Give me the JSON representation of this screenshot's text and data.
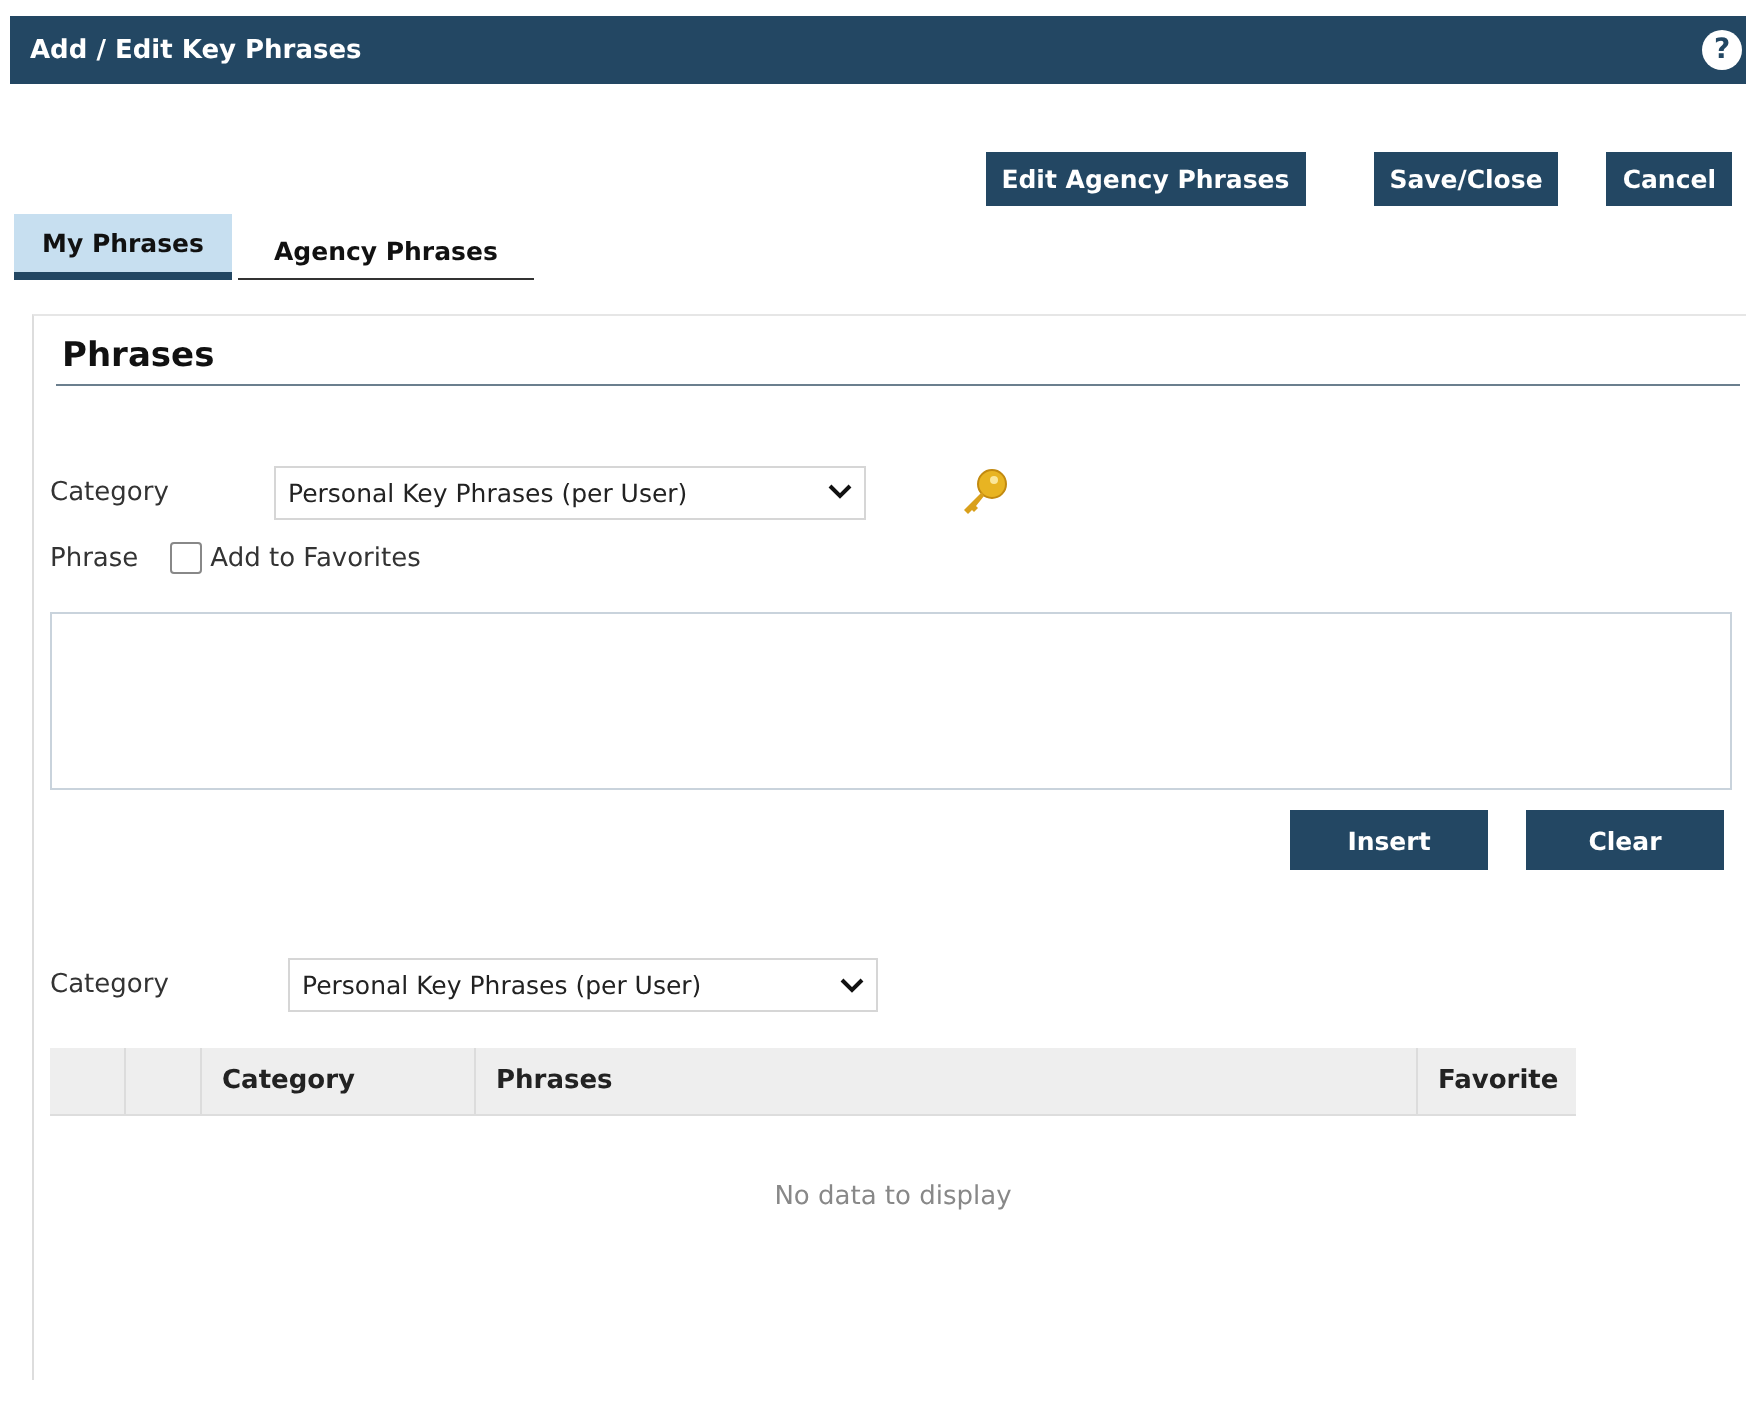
{
  "window": {
    "title": "Add / Edit Key Phrases",
    "help_icon": "?"
  },
  "actions": [
    "Edit Agency Phrases",
    "Save/Close",
    "Cancel"
  ],
  "tabs": [
    {
      "label": "My Phrases",
      "selected": true
    },
    {
      "label": "Agency Phrases",
      "selected": false
    }
  ],
  "section": {
    "title": "Phrases"
  },
  "category": {
    "label": "Category",
    "value": "Personal Key Phrases (per User)"
  },
  "phrase": {
    "label": "Phrase",
    "favorite_label": "Add to Favorites",
    "favorite_checked": false
  },
  "phrase_buttons": [
    "Insert",
    "Clear"
  ],
  "filter": {
    "label": "Category",
    "value": "Personal Key Phrases (per User)"
  },
  "table": {
    "columns": [
      "",
      "",
      "Category",
      "Phrases",
      "Favorite"
    ],
    "empty_text": "No data to display"
  }
}
